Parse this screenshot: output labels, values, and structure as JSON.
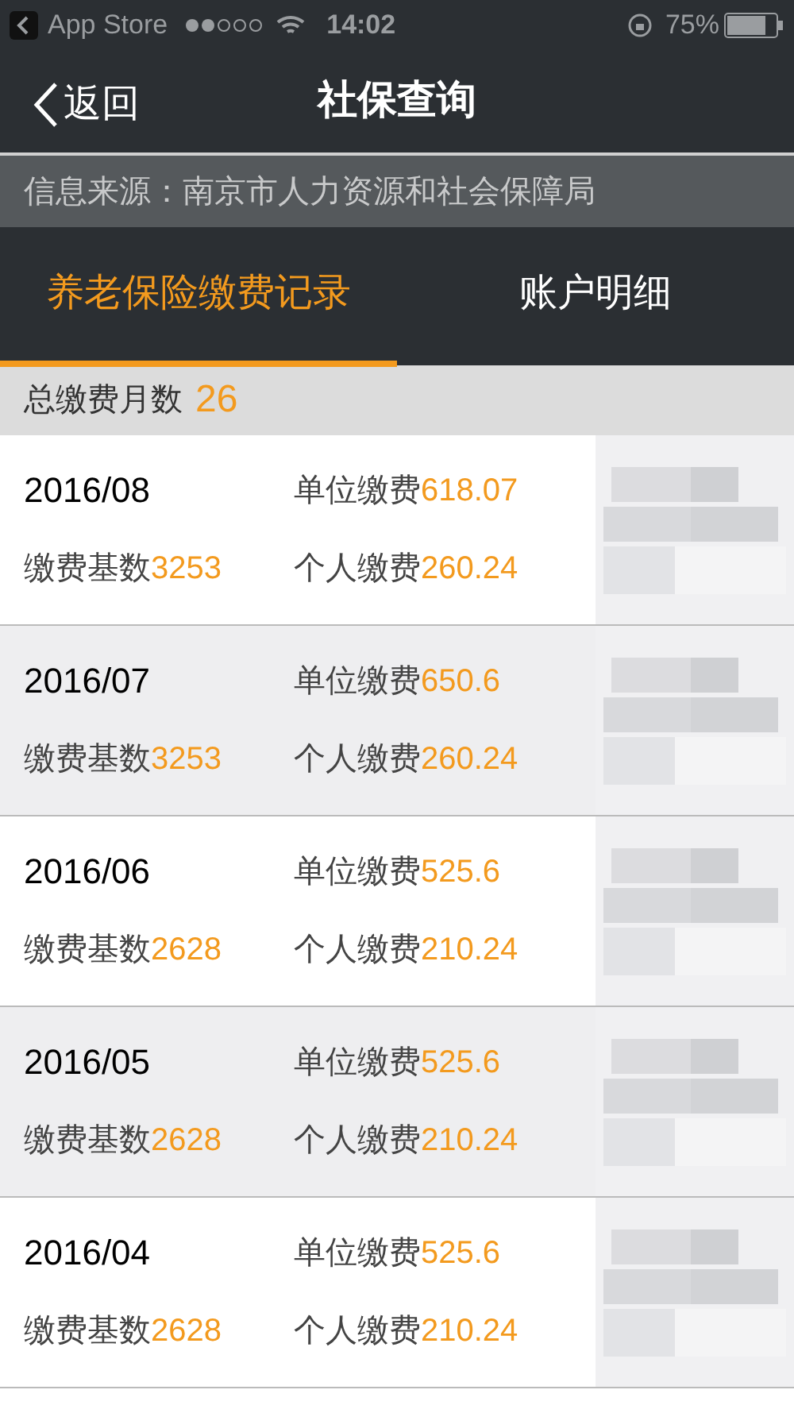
{
  "status_bar": {
    "back_app": "App Store",
    "time": "14:02",
    "battery": "75%"
  },
  "nav": {
    "back": "返回",
    "title": "社保查询"
  },
  "source": "信息来源：南京市人力资源和社会保障局",
  "tabs": [
    {
      "label": "养老保险缴费记录",
      "selected": true
    },
    {
      "label": "账户明细",
      "selected": false
    }
  ],
  "summary": {
    "label": "总缴费月数",
    "value": "26"
  },
  "records": [
    {
      "month": "2016/08",
      "unit_label": "单位缴费",
      "unit": "618.07",
      "base_label": "缴费基数",
      "base": "3253",
      "personal_label": "个人缴费",
      "personal": "260.24"
    },
    {
      "month": "2016/07",
      "unit_label": "单位缴费",
      "unit": "650.6",
      "base_label": "缴费基数",
      "base": "3253",
      "personal_label": "个人缴费",
      "personal": "260.24"
    },
    {
      "month": "2016/06",
      "unit_label": "单位缴费",
      "unit": "525.6",
      "base_label": "缴费基数",
      "base": "2628",
      "personal_label": "个人缴费",
      "personal": "210.24"
    },
    {
      "month": "2016/05",
      "unit_label": "单位缴费",
      "unit": "525.6",
      "base_label": "缴费基数",
      "base": "2628",
      "personal_label": "个人缴费",
      "personal": "210.24"
    },
    {
      "month": "2016/04",
      "unit_label": "单位缴费",
      "unit": "525.6",
      "base_label": "缴费基数",
      "base": "2628",
      "personal_label": "个人缴费",
      "personal": "210.24"
    }
  ]
}
